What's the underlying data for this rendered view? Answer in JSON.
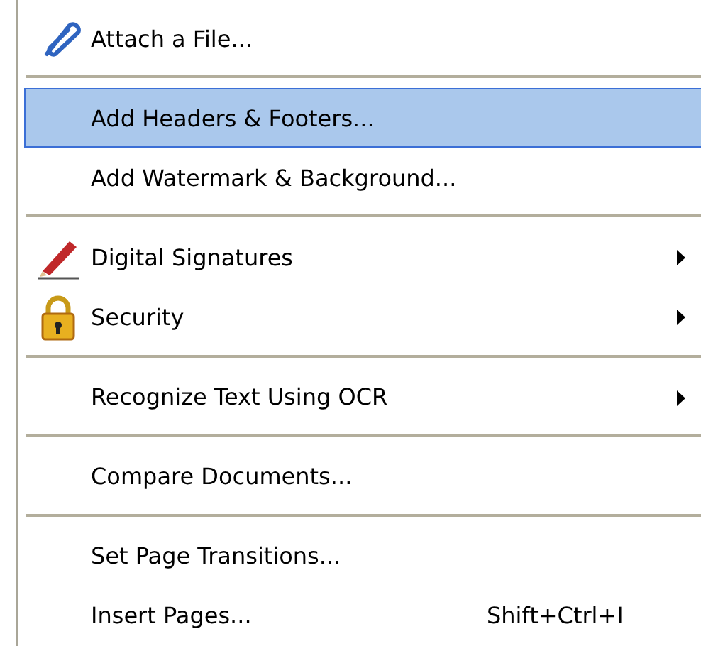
{
  "menu": {
    "items": [
      {
        "kind": "item",
        "label": "Attach a File...",
        "selected": false,
        "submenu": false
      },
      {
        "kind": "separator"
      },
      {
        "kind": "item",
        "label": "Add Headers & Footers...",
        "selected": true,
        "submenu": false
      },
      {
        "kind": "item",
        "label": "Add Watermark & Background...",
        "selected": false,
        "submenu": false
      },
      {
        "kind": "separator"
      },
      {
        "kind": "item",
        "label": "Digital Signatures",
        "selected": false,
        "submenu": true
      },
      {
        "kind": "item",
        "label": "Security",
        "selected": false,
        "submenu": true
      },
      {
        "kind": "separator"
      },
      {
        "kind": "item",
        "label": "Recognize Text Using OCR",
        "selected": false,
        "submenu": true
      },
      {
        "kind": "separator"
      },
      {
        "kind": "item",
        "label": "Compare Documents...",
        "selected": false,
        "submenu": false
      },
      {
        "kind": "separator"
      },
      {
        "kind": "item",
        "label": "Set Page Transitions...",
        "selected": false,
        "submenu": false
      },
      {
        "kind": "item",
        "label": "Insert Pages...",
        "shortcut": "Shift+Ctrl+I",
        "selected": false,
        "submenu": false
      }
    ]
  }
}
